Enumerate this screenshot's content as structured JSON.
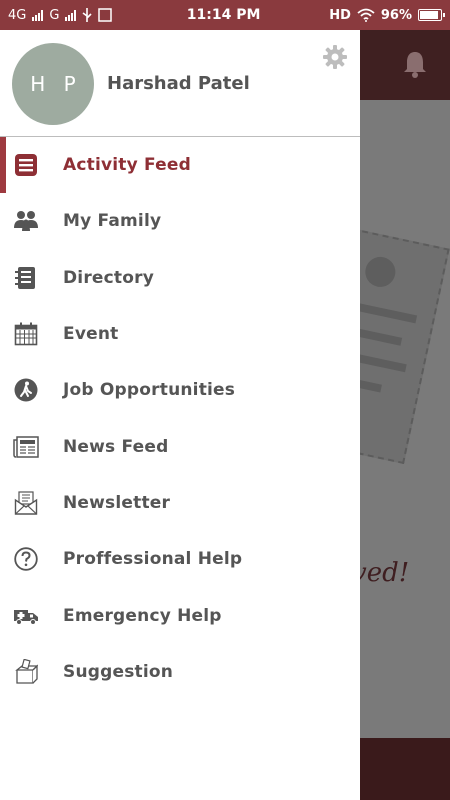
{
  "status_bar": {
    "network1": "4G",
    "network2": "G",
    "time": "11:14 PM",
    "hd": "HD",
    "battery_text": "96%",
    "battery_level": 0.96
  },
  "drawer": {
    "avatar_initials": "H P",
    "user_name": "Harshad Patel",
    "menu": [
      {
        "label": "Activity Feed",
        "icon": "list-icon",
        "active": true
      },
      {
        "label": "My Family",
        "icon": "family-icon",
        "active": false
      },
      {
        "label": "Directory",
        "icon": "directory-icon",
        "active": false
      },
      {
        "label": "Event",
        "icon": "calendar-icon",
        "active": false
      },
      {
        "label": "Job Opportunities",
        "icon": "job-icon",
        "active": false
      },
      {
        "label": "News Feed",
        "icon": "newspaper-icon",
        "active": false
      },
      {
        "label": "Newsletter",
        "icon": "envelope-icon",
        "active": false
      },
      {
        "label": "Proffessional Help",
        "icon": "question-icon",
        "active": false
      },
      {
        "label": "Emergency Help",
        "icon": "ambulance-icon",
        "active": false
      },
      {
        "label": "Suggestion",
        "icon": "suggestion-box-icon",
        "active": false
      }
    ]
  },
  "background": {
    "visible_text": "ved!"
  },
  "colors": {
    "status_bar": "#8a3a3e",
    "accent": "#8e2f35",
    "avatar_bg": "#9eaba0"
  }
}
